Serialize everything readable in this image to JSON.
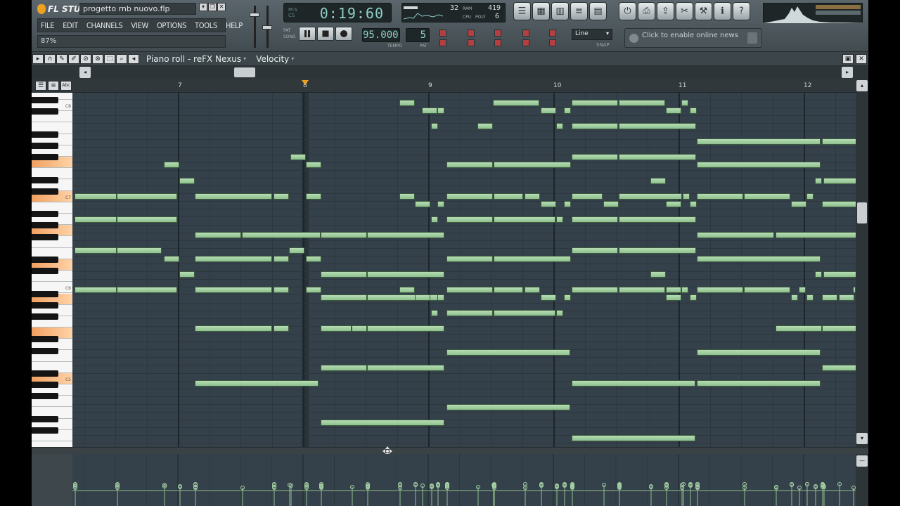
{
  "app": {
    "logo_text": "FL STUDIO",
    "project_name": "progetto rnb nuovo.flp",
    "menu": [
      "FILE",
      "EDIT",
      "CHANNELS",
      "VIEW",
      "OPTIONS",
      "TOOLS",
      "HELP"
    ],
    "hint_value": "87%"
  },
  "transport": {
    "time": "0:19:60",
    "tempo": "95.000",
    "pattern": "5",
    "tempo_label": "TEMPO",
    "pattern_label": "PAT",
    "mode_labels": [
      "PAT",
      "SONG"
    ]
  },
  "monitor": {
    "cpu_top": "32",
    "mem": "419",
    "poly": "6",
    "labels": [
      "RAM",
      "CPU",
      "POLY"
    ]
  },
  "snap": {
    "value": "Line",
    "label": "SNAP"
  },
  "news": {
    "text": "Click to enable online news"
  },
  "piano_roll": {
    "title": "Piano roll - reFX Nexus",
    "control": "Velocity",
    "bar_labels": [
      "7",
      "8",
      "9",
      "10",
      "11",
      "12"
    ],
    "key_labels": [
      "C8",
      "C7",
      "C6",
      "C5"
    ],
    "notes": [
      [
        465,
        142,
        22
      ],
      [
        497,
        153,
        22
      ],
      [
        519,
        153,
        10
      ],
      [
        510,
        175,
        10
      ],
      [
        598,
        142,
        66
      ],
      [
        666,
        153,
        22
      ],
      [
        699,
        153,
        10
      ],
      [
        710,
        142,
        66
      ],
      [
        777,
        142,
        66
      ],
      [
        844,
        153,
        22
      ],
      [
        866,
        142,
        10
      ],
      [
        878,
        153,
        10
      ],
      [
        576,
        175,
        22
      ],
      [
        688,
        175,
        10
      ],
      [
        710,
        175,
        66
      ],
      [
        777,
        175,
        110
      ],
      [
        888,
        197,
        176
      ],
      [
        1066,
        197,
        50
      ],
      [
        310,
        219,
        22
      ],
      [
        710,
        219,
        66
      ],
      [
        777,
        219,
        110
      ],
      [
        130,
        230,
        22
      ],
      [
        332,
        230,
        22
      ],
      [
        532,
        230,
        66
      ],
      [
        599,
        230,
        110
      ],
      [
        888,
        230,
        176
      ],
      [
        152,
        253,
        22
      ],
      [
        822,
        253,
        22
      ],
      [
        1056,
        253,
        10
      ],
      [
        1068,
        253,
        50
      ],
      [
        3,
        275,
        60
      ],
      [
        63,
        275,
        86
      ],
      [
        174,
        275,
        110
      ],
      [
        286,
        275,
        22
      ],
      [
        332,
        275,
        22
      ],
      [
        465,
        275,
        22
      ],
      [
        532,
        275,
        66
      ],
      [
        599,
        275,
        42
      ],
      [
        643,
        275,
        22
      ],
      [
        710,
        275,
        44
      ],
      [
        777,
        275,
        90
      ],
      [
        868,
        275,
        10
      ],
      [
        888,
        275,
        66
      ],
      [
        955,
        275,
        66
      ],
      [
        1044,
        275,
        10
      ],
      [
        487,
        286,
        22
      ],
      [
        519,
        286,
        10
      ],
      [
        666,
        286,
        22
      ],
      [
        699,
        286,
        10
      ],
      [
        755,
        286,
        22
      ],
      [
        844,
        286,
        22
      ],
      [
        878,
        286,
        10
      ],
      [
        1022,
        286,
        22
      ],
      [
        1066,
        286,
        50
      ],
      [
        3,
        308,
        60
      ],
      [
        63,
        308,
        86
      ],
      [
        510,
        308,
        10
      ],
      [
        532,
        308,
        66
      ],
      [
        599,
        308,
        88
      ],
      [
        688,
        308,
        10
      ],
      [
        710,
        308,
        66
      ],
      [
        777,
        308,
        110
      ],
      [
        174,
        330,
        66
      ],
      [
        241,
        330,
        112
      ],
      [
        353,
        330,
        66
      ],
      [
        419,
        330,
        110
      ],
      [
        888,
        330,
        110
      ],
      [
        1000,
        330,
        116
      ],
      [
        3,
        352,
        60
      ],
      [
        63,
        352,
        64
      ],
      [
        308,
        352,
        22
      ],
      [
        710,
        352,
        66
      ],
      [
        777,
        352,
        110
      ],
      [
        130,
        364,
        22
      ],
      [
        174,
        364,
        110
      ],
      [
        286,
        364,
        22
      ],
      [
        332,
        364,
        22
      ],
      [
        532,
        364,
        66
      ],
      [
        599,
        364,
        110
      ],
      [
        888,
        364,
        176
      ],
      [
        353,
        386,
        66
      ],
      [
        419,
        386,
        110
      ],
      [
        152,
        386,
        22
      ],
      [
        822,
        386,
        22
      ],
      [
        1056,
        386,
        10
      ],
      [
        1068,
        386,
        50
      ],
      [
        3,
        408,
        60
      ],
      [
        63,
        408,
        86
      ],
      [
        174,
        408,
        110
      ],
      [
        286,
        408,
        22
      ],
      [
        332,
        408,
        22
      ],
      [
        465,
        408,
        22
      ],
      [
        532,
        408,
        66
      ],
      [
        599,
        408,
        42
      ],
      [
        643,
        408,
        22
      ],
      [
        710,
        408,
        66
      ],
      [
        777,
        408,
        66
      ],
      [
        844,
        408,
        22
      ],
      [
        866,
        408,
        10
      ],
      [
        888,
        408,
        66
      ],
      [
        955,
        408,
        66
      ],
      [
        1033,
        408,
        10
      ],
      [
        1110,
        408,
        4
      ],
      [
        353,
        419,
        66
      ],
      [
        419,
        419,
        110
      ],
      [
        487,
        419,
        22
      ],
      [
        519,
        419,
        10
      ],
      [
        666,
        419,
        22
      ],
      [
        699,
        419,
        10
      ],
      [
        844,
        419,
        22
      ],
      [
        878,
        419,
        10
      ],
      [
        1022,
        419,
        10
      ],
      [
        1044,
        419,
        10
      ],
      [
        1066,
        419,
        22
      ],
      [
        1090,
        419,
        22
      ],
      [
        510,
        441,
        10
      ],
      [
        532,
        441,
        66
      ],
      [
        599,
        441,
        88
      ],
      [
        688,
        441,
        10
      ],
      [
        174,
        463,
        110
      ],
      [
        286,
        463,
        22
      ],
      [
        353,
        463,
        44
      ],
      [
        397,
        463,
        22
      ],
      [
        419,
        463,
        110
      ],
      [
        1000,
        463,
        66
      ],
      [
        1066,
        463,
        50
      ],
      [
        532,
        497,
        176
      ],
      [
        888,
        497,
        176
      ],
      [
        353,
        519,
        66
      ],
      [
        419,
        519,
        110
      ],
      [
        1066,
        519,
        50
      ],
      [
        174,
        541,
        176
      ],
      [
        710,
        541,
        176
      ],
      [
        888,
        541,
        176
      ],
      [
        532,
        575,
        176
      ],
      [
        353,
        597,
        176
      ],
      [
        710,
        619,
        176
      ]
    ]
  },
  "colors": {
    "note": "#a6d2a6",
    "grid_bg": "#35414a",
    "accent_orange": "#f0a020",
    "lcd_text": "#8fd0c8"
  }
}
